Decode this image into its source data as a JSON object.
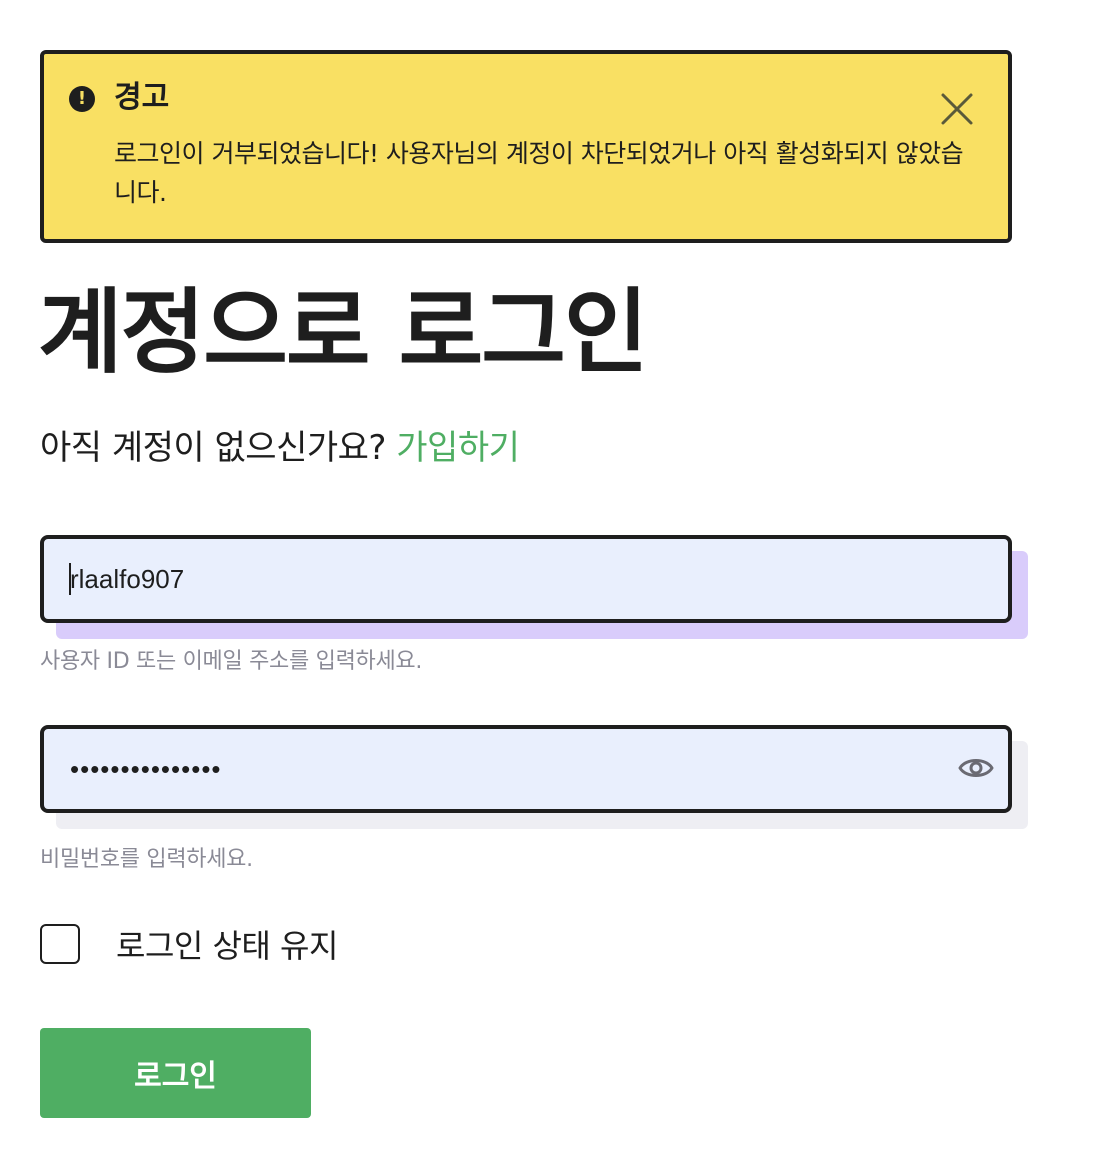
{
  "alert": {
    "icon": "exclamation-circle-icon",
    "title": "경고",
    "message": "로그인이 거부되었습니다! 사용자님의 계정이 차단되었거나 아직 활성화되지 않았습니다.",
    "close_icon": "close-icon",
    "background_color": "#f9e063"
  },
  "heading": {
    "title": "계정으로 로그인"
  },
  "signup": {
    "prompt": "아직 계정이 없으신가요?",
    "link_label": "가입하기",
    "link_color": "#4fae63"
  },
  "username": {
    "value": "rlaalfo907",
    "hint": "사용자 ID 또는 이메일 주소를 입력하세요."
  },
  "password": {
    "value": "•••••••••••••••",
    "hint": "비밀번호를 입력하세요.",
    "toggle_icon": "eye-icon"
  },
  "remember": {
    "label": "로그인 상태 유지",
    "checked": false
  },
  "submit": {
    "label": "로그인",
    "color": "#4fae63"
  }
}
